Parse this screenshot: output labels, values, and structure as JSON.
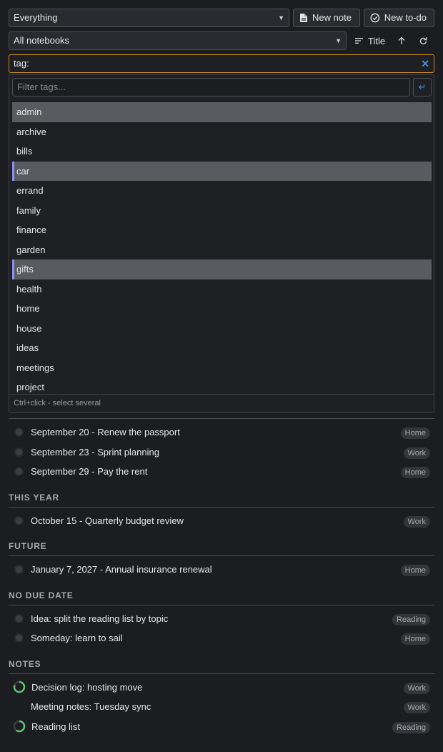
{
  "toolbar": {
    "scope_select": "Everything",
    "new_note_label": "New note",
    "new_todo_label": "New to-do",
    "notebook_select": "All notebooks",
    "sort_label": "Title"
  },
  "search": {
    "value": "tag:",
    "clear_icon": "close-icon"
  },
  "tag_picker": {
    "filter_placeholder": "Filter tags...",
    "tags": [
      "admin",
      "archive",
      "bills",
      "car",
      "errand",
      "family",
      "finance",
      "garden",
      "gifts",
      "health",
      "home",
      "house",
      "ideas",
      "meetings",
      "project"
    ],
    "highlighted": "admin",
    "selected": [
      "car",
      "gifts"
    ],
    "hint": "Ctrl+click - select several"
  },
  "list": {
    "upcoming": [
      {
        "title": "September 20 - Renew the passport",
        "badge": "Home"
      },
      {
        "title": "September 23 - Sprint planning",
        "badge": "Work"
      },
      {
        "title": "September 29 - Pay the rent",
        "badge": "Home"
      }
    ],
    "this_year": {
      "heading": "THIS YEAR",
      "items": [
        {
          "title": "October 15 - Quarterly budget review",
          "badge": "Work"
        }
      ]
    },
    "future": {
      "heading": "FUTURE",
      "items": [
        {
          "title": "January 7, 2027 - Annual insurance renewal",
          "badge": "Home"
        }
      ]
    },
    "no_due": {
      "heading": "NO DUE DATE",
      "items": [
        {
          "title": "Idea: split the reading list by topic",
          "badge": "Reading"
        },
        {
          "title": "Someday: learn to sail",
          "badge": "Home"
        }
      ]
    },
    "notes": {
      "heading": "NOTES",
      "items": [
        {
          "title": "Decision log: hosting move",
          "badge": "Work",
          "progress": 0.8
        },
        {
          "title": "Meeting notes: Tuesday sync",
          "badge": "Work"
        },
        {
          "title": "Reading list",
          "badge": "Reading",
          "progress": 0.6
        }
      ]
    }
  },
  "colors": {
    "accent_focus": "#c58a2a",
    "accent_blue": "#4b8ed8",
    "selected_bar": "#8a8ff0",
    "progress_green": "#5cc46a"
  }
}
